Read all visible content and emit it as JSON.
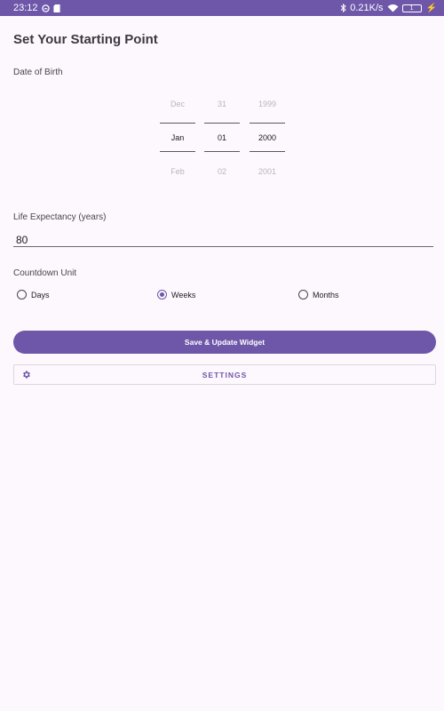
{
  "status_bar": {
    "time": "23:12",
    "network_speed": "0.21K/s",
    "battery_level": "1",
    "icons": [
      "sim-icon",
      "storage-icon",
      "bluetooth-icon",
      "wifi-icon",
      "battery-icon",
      "charging-icon"
    ]
  },
  "page": {
    "title": "Set Your Starting Point"
  },
  "dob": {
    "label": "Date of Birth",
    "month": {
      "prev": "Dec",
      "current": "Jan",
      "next": "Feb"
    },
    "day": {
      "prev": "31",
      "current": "01",
      "next": "02"
    },
    "year": {
      "prev": "1999",
      "current": "2000",
      "next": "2001"
    }
  },
  "life": {
    "label": "Life Expectancy (years)",
    "value": "80"
  },
  "countdown": {
    "label": "Countdown Unit",
    "selected": "Weeks",
    "options": [
      "Days",
      "Weeks",
      "Months"
    ]
  },
  "actions": {
    "save_label": "Save & Update Widget",
    "settings_label": "SETTINGS"
  },
  "colors": {
    "primary": "#6e56a8",
    "background": "#fdf8fd"
  }
}
